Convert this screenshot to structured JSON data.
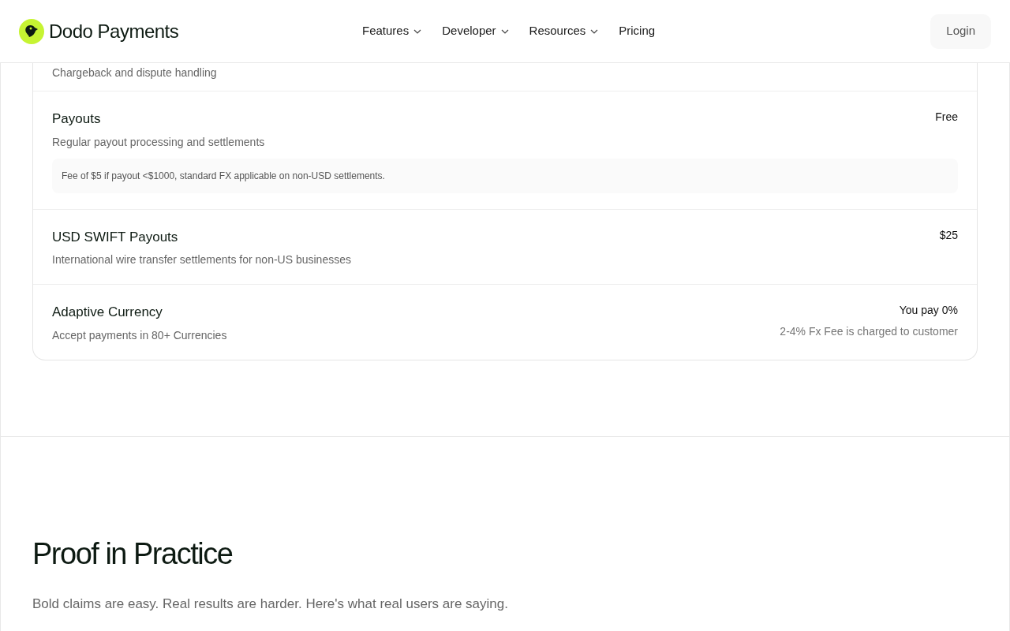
{
  "header": {
    "brand": "Dodo Payments",
    "nav": [
      {
        "label": "Features",
        "dropdown": true
      },
      {
        "label": "Developer",
        "dropdown": true
      },
      {
        "label": "Resources",
        "dropdown": true
      },
      {
        "label": "Pricing",
        "dropdown": false
      }
    ],
    "login": "Login"
  },
  "fees": [
    {
      "description": "Chargeback and dispute handling"
    },
    {
      "title": "Payouts",
      "description": "Regular payout processing and settlements",
      "price": "Free",
      "note": "Fee of $5 if payout <$1000, standard FX applicable on non-USD settlements."
    },
    {
      "title": "USD SWIFT Payouts",
      "description": "International wire transfer settlements for non-US businesses",
      "price": "$25"
    },
    {
      "title": "Adaptive Currency",
      "description": "Accept payments in 80+ Currencies",
      "price": "You pay 0%",
      "price_note": "2-4% Fx Fee is charged to customer"
    }
  ],
  "proof": {
    "heading": "Proof in Practice",
    "subtitle": "Bold claims are easy. Real results are harder. Here's what real users are saying."
  }
}
